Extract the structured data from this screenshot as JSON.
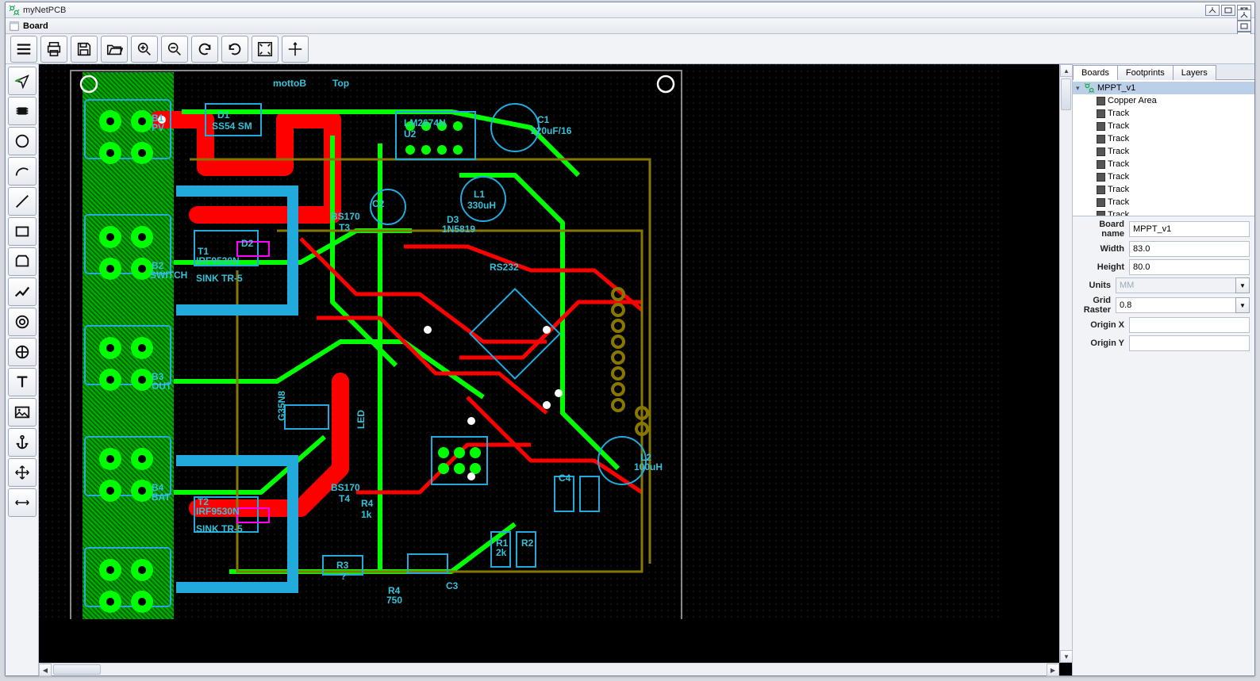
{
  "app": {
    "title": "myNetPCB",
    "sub_title": "Board"
  },
  "window_buttons": {
    "min": "□",
    "max": "❐",
    "close": "⊠"
  },
  "toolbar": [
    {
      "name": "menu-icon",
      "title": "Menu"
    },
    {
      "name": "print-icon",
      "title": "Print"
    },
    {
      "name": "save-icon",
      "title": "Save"
    },
    {
      "name": "open-icon",
      "title": "Open"
    },
    {
      "name": "zoom-in-icon",
      "title": "Zoom In"
    },
    {
      "name": "zoom-out-icon",
      "title": "Zoom Out"
    },
    {
      "name": "undo-icon",
      "title": "Undo"
    },
    {
      "name": "redo-icon",
      "title": "Redo"
    },
    {
      "name": "fit-icon",
      "title": "Fit to screen"
    },
    {
      "name": "origin-tool-icon",
      "title": "Set origin"
    }
  ],
  "side_tools": [
    {
      "name": "select-tool-icon"
    },
    {
      "name": "footprint-tool-icon"
    },
    {
      "name": "circle-tool-icon"
    },
    {
      "name": "arc-tool-icon"
    },
    {
      "name": "line-tool-icon"
    },
    {
      "name": "rect-tool-icon"
    },
    {
      "name": "outline-tool-icon"
    },
    {
      "name": "track-tool-icon"
    },
    {
      "name": "via-tool-icon"
    },
    {
      "name": "pad-tool-icon"
    },
    {
      "name": "text-tool-icon"
    },
    {
      "name": "image-tool-icon"
    },
    {
      "name": "anchor-tool-icon"
    },
    {
      "name": "move-tool-icon"
    },
    {
      "name": "measure-tool-icon"
    }
  ],
  "tabs": [
    {
      "label": "Boards",
      "active": true
    },
    {
      "label": "Footprints",
      "active": false
    },
    {
      "label": "Layers",
      "active": false
    }
  ],
  "tree": {
    "root": {
      "label": "MPPT_v1"
    },
    "children": [
      {
        "label": "Copper Area"
      },
      {
        "label": "Track"
      },
      {
        "label": "Track"
      },
      {
        "label": "Track"
      },
      {
        "label": "Track"
      },
      {
        "label": "Track"
      },
      {
        "label": "Track"
      },
      {
        "label": "Track"
      },
      {
        "label": "Track"
      },
      {
        "label": "Track"
      }
    ]
  },
  "props": {
    "board_name_label": "Board name",
    "board_name": "MPPT_v1",
    "width_label": "Width",
    "width": "83.0",
    "height_label": "Height",
    "height": "80.0",
    "units_label": "Units",
    "units": "MM",
    "grid_raster_label": "Grid Raster",
    "grid_raster": "0.8",
    "origin_x_label": "Origin X",
    "origin_x": "",
    "origin_y_label": "Origin Y",
    "origin_y": ""
  },
  "pcb_labels": {
    "top": "Top",
    "bottom": "mottoB",
    "d1": "D1",
    "d1_part": "SS54 SM",
    "u2": "U2",
    "u2_part": "LM2674N",
    "c1": "C1",
    "c1_val": "220uF/16",
    "l1": "L1",
    "l1_val": "330uH",
    "c2": "C2",
    "t3": "T3",
    "t3_part": "BS170",
    "d3": "D3",
    "d3_part": "1N5819",
    "t1": "T1",
    "t1_part": "IRF9530N",
    "b1": "B1",
    "b1_label": "PV",
    "b2": "B2",
    "b2_label": "SWITCH",
    "b3": "B3",
    "b3_label": "OUT",
    "b4": "B4",
    "b4_label": "BAT",
    "sink1": "SINK TR-5",
    "r4": "R4",
    "r4_val": "1k",
    "led": "LED",
    "rs232": "RS232",
    "d2": "D2",
    "t2": "T2",
    "t2_part": "IRF9530N",
    "t4": "T4",
    "t4_part": "BS170",
    "sink2": "SINK TR-5",
    "r3": "R3",
    "r3_val": "?",
    "r4b": "R4",
    "r4b_val": "750",
    "c3": "C3",
    "c3_val": "?",
    "c4": "C4",
    "l2": "L2",
    "l2_val": "100uH",
    "r1": "R1",
    "r1_val": "2k",
    "r2": "R2",
    "g3": "G35N8"
  }
}
